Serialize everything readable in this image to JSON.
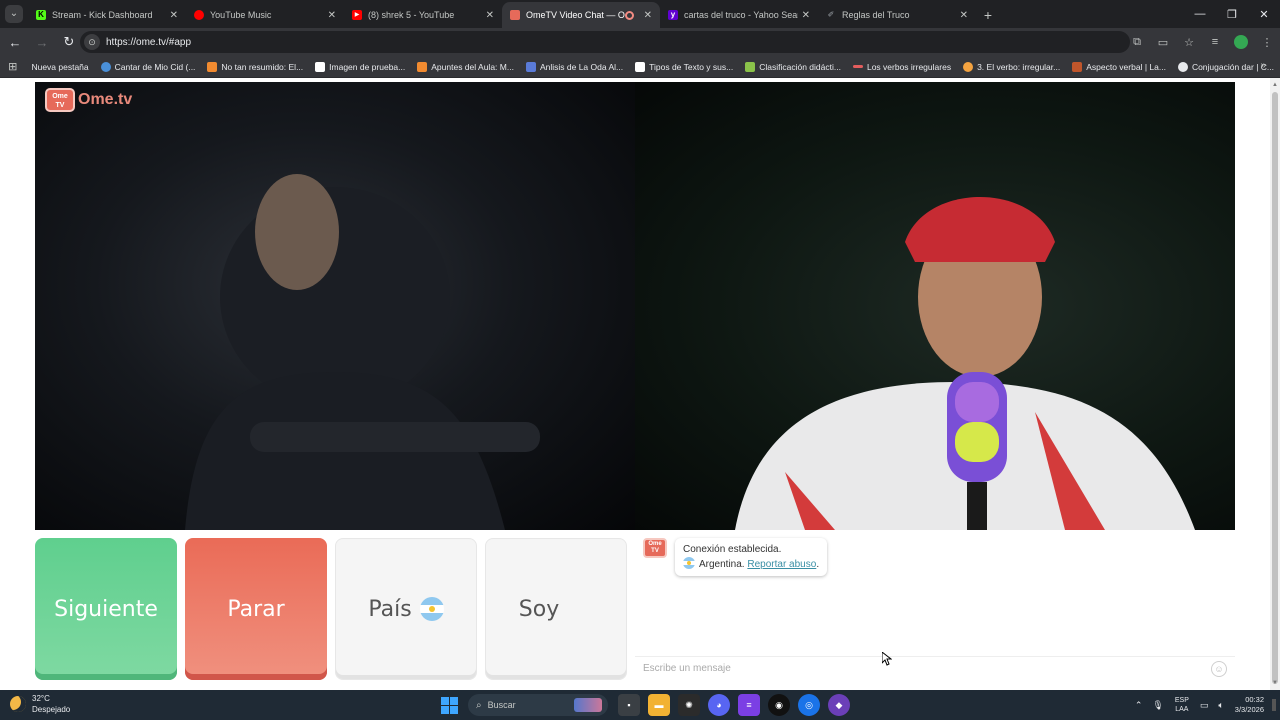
{
  "browser": {
    "tabs": [
      {
        "title": "Stream - Kick Dashboard",
        "favicon": "kick-icon",
        "color": "#53fc18",
        "active": false
      },
      {
        "title": "YouTube Music",
        "favicon": "youtube-music-icon",
        "color": "#ff0000",
        "active": false
      },
      {
        "title": "(8) shrek 5 - YouTube",
        "favicon": "youtube-icon",
        "color": "#ff0000",
        "active": false
      },
      {
        "title": "OmeTV Video Chat — Ome",
        "favicon": "ometv-icon",
        "color": "#e66a5a",
        "active": true
      },
      {
        "title": "cartas del truco - Yahoo Search",
        "favicon": "yahoo-icon",
        "color": "#6001d2",
        "active": false
      },
      {
        "title": "Reglas del Truco",
        "favicon": "page-icon",
        "color": "#9aa0a6",
        "active": false
      }
    ],
    "new_tab": "+",
    "url": "https://ome.tv/#app",
    "bookmarks": [
      {
        "label": "Nueva pestaña",
        "color": "#35363a"
      },
      {
        "label": "Cantar de Mio Cid (...",
        "color": "#4a90d9"
      },
      {
        "label": "No tan resumido: El...",
        "color": "#f28b30"
      },
      {
        "label": "Imagen de prueba...",
        "color": "#ffffff"
      },
      {
        "label": "Apuntes del Aula: M...",
        "color": "#f28b30"
      },
      {
        "label": "Anlisis de La Oda Al...",
        "color": "#5a7bd8"
      },
      {
        "label": "Tipos de Texto y sus...",
        "color": "#ffffff"
      },
      {
        "label": "Clasificación didácti...",
        "color": "#8bc34a"
      },
      {
        "label": "Los verbos irregulares",
        "color": "#e35d5d"
      },
      {
        "label": "3. El verbo: irregular...",
        "color": "#f4a340"
      },
      {
        "label": "Aspecto verbal | La...",
        "color": "#c0562b"
      },
      {
        "label": "Conjugación dar | C...",
        "color": "#e8eaed"
      }
    ]
  },
  "app": {
    "logo_badge": "Ome TV",
    "logo_text": "Ome.tv",
    "buttons": {
      "next": "Siguiente",
      "stop": "Parar",
      "country": "País",
      "gender": "Soy"
    },
    "chat": {
      "system_line1": "Conexión establecida.",
      "system_country": "Argentina.",
      "report_link": "Reportar abuso",
      "report_suffix": ".",
      "input_placeholder": "Escribe un mensaje"
    },
    "colors": {
      "next": "#5fcf8e",
      "stop": "#ea6b57",
      "brand": "#e66a5a"
    }
  },
  "taskbar": {
    "weather_temp": "32°C",
    "weather_desc": "Despejado",
    "search_label": "Buscar",
    "lang_line1": "ESP",
    "lang_line2": "LAA",
    "time": "00:32",
    "date": "3/3/2026"
  }
}
